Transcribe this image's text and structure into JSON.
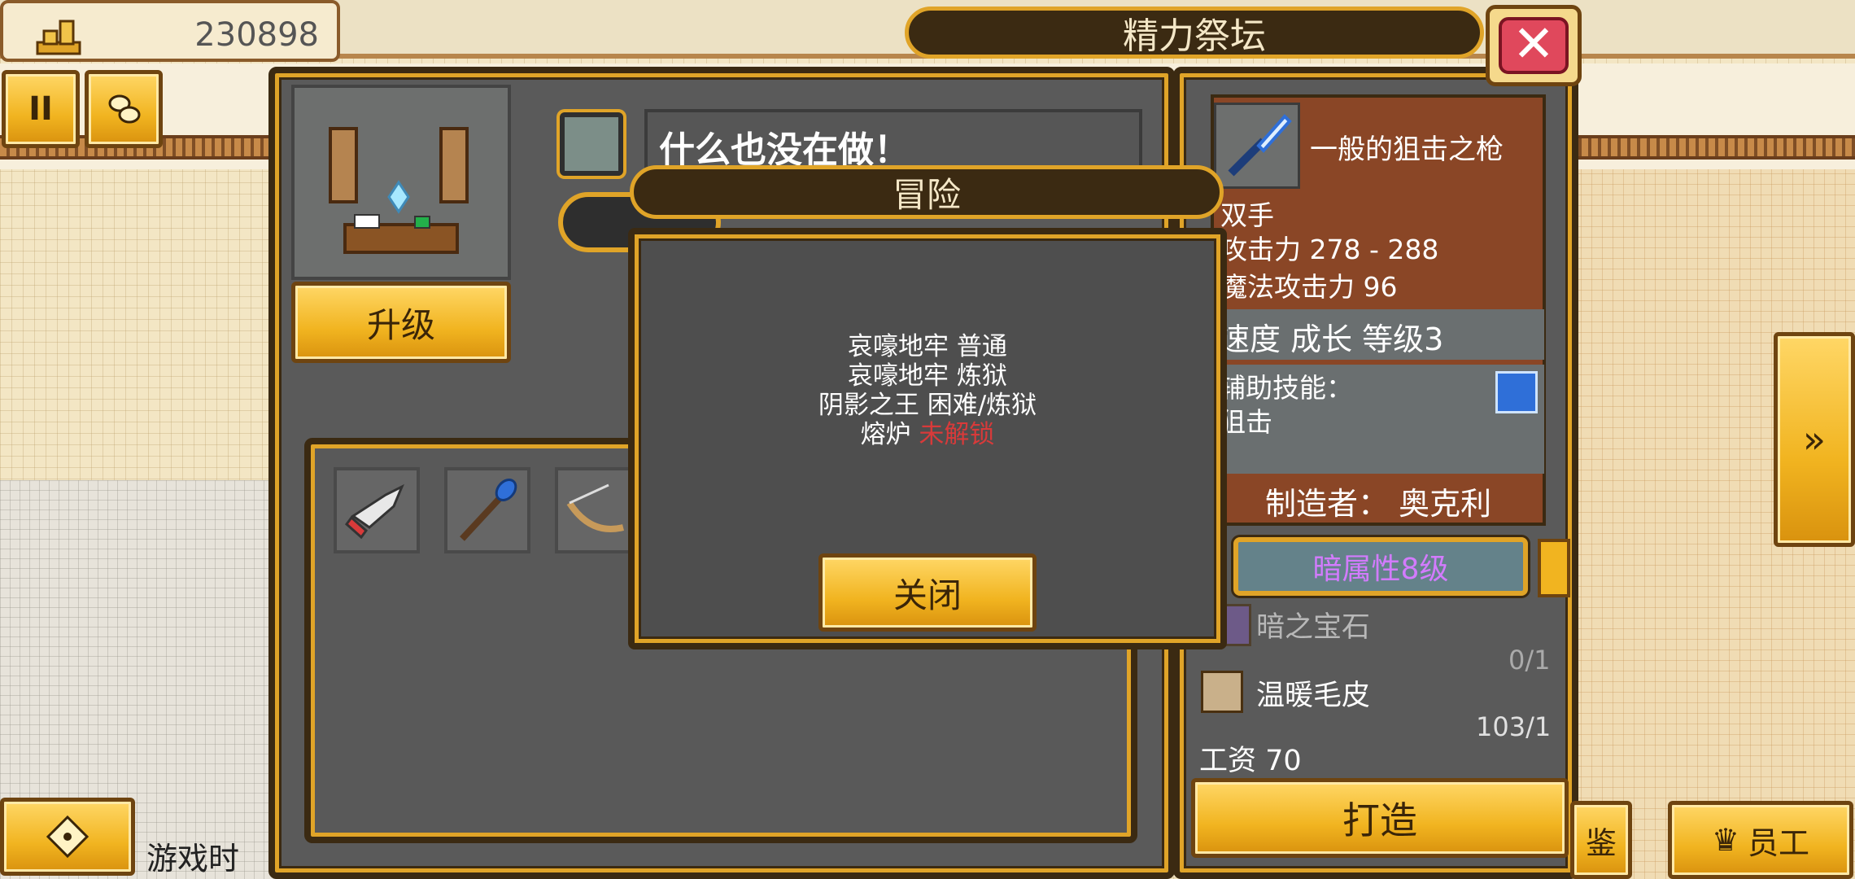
{
  "hud": {
    "money": "230898",
    "money_icon": "coin-stack-icon",
    "pause_label": "II",
    "extra_icon": "coins-icon",
    "next_icon": "fast-forward-icon",
    "bottom_left_icon": "dpad-icon",
    "playtime_label": "游戏时",
    "bottom_right_partial_label": "鉴",
    "staff_label": "员工"
  },
  "panel": {
    "title": "精力祭坛",
    "close_icon": "close-x-icon",
    "upgrade_label": "升级",
    "status_text": "什么也没在做！",
    "items": [
      "red-sword-icon",
      "blue-staff-icon",
      "bow-icon"
    ]
  },
  "dialog": {
    "title": "冒险",
    "lines": [
      {
        "text": "哀嚎地牢  普通",
        "locked": ""
      },
      {
        "text": "哀嚎地牢  炼狱",
        "locked": ""
      },
      {
        "text": "阴影之王  困难/炼狱",
        "locked": ""
      },
      {
        "text": "熔炉  ",
        "locked": "未解锁"
      }
    ],
    "close_label": "关闭"
  },
  "weapon": {
    "name": "一般的狙击之枪",
    "hand": "双手",
    "attack": "攻击力 278 - 288",
    "magic_attack": "魔法攻击力 96",
    "speed_row": "速度 成长 等级3",
    "support_skill_label": "辅助技能：",
    "support_skill_value": "狙击",
    "maker": "制造者：  奥克利",
    "element": "暗属性8级"
  },
  "materials": [
    {
      "name": "暗之宝石",
      "count": "0/1",
      "available": false
    },
    {
      "name": "温暖毛皮",
      "count": "103/1",
      "available": true
    }
  ],
  "wage": "工资 70",
  "craft_label": "打造",
  "colors": {
    "gold": "#f1b420",
    "dark_border": "#3b2a12",
    "panel_grey": "#5a5a5a",
    "weapon_card": "#8a4626",
    "close_red": "#e0485c",
    "locked_red": "#d83a3a",
    "element_purple": "#d37bff"
  }
}
